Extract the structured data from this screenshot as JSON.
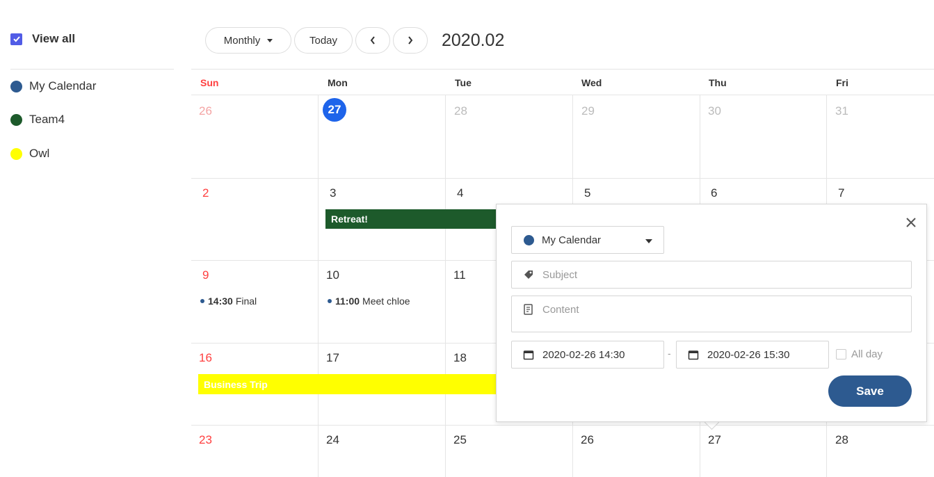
{
  "sidebar": {
    "view_all": "View all",
    "calendars": [
      {
        "name": "My Calendar",
        "color": "#2d5a90"
      },
      {
        "name": "Team4",
        "color": "#1d5a2b"
      },
      {
        "name": "Owl",
        "color": "#ffff00"
      }
    ]
  },
  "toolbar": {
    "view_select": "Monthly",
    "today": "Today",
    "range": "2020.02"
  },
  "calendar": {
    "daynames": [
      "Sun",
      "Mon",
      "Tue",
      "Wed",
      "Thu",
      "Fri"
    ],
    "weeks": [
      [
        "26",
        "27",
        "28",
        "29",
        "30",
        "31"
      ],
      [
        "2",
        "3",
        "4",
        "5",
        "6",
        "7"
      ],
      [
        "9",
        "10",
        "11",
        "",
        "",
        ""
      ],
      [
        "16",
        "17",
        "18",
        "",
        "",
        ""
      ],
      [
        "23",
        "24",
        "25",
        "26",
        "27",
        "28"
      ]
    ],
    "events": {
      "retreat": {
        "title": "Retreat!",
        "color": "#1d5a2b"
      },
      "final": {
        "time": "14:30",
        "title": "Final"
      },
      "meet": {
        "time": "11:00",
        "title": "Meet chloe"
      },
      "trip": {
        "title": "Business Trip",
        "color": "#ffff00"
      }
    }
  },
  "popup": {
    "calendar": "My Calendar",
    "subject_placeholder": "Subject",
    "content_placeholder": "Content",
    "start": "2020-02-26 14:30",
    "end": "2020-02-26 15:30",
    "separator": "-",
    "allday": "All day",
    "save": "Save"
  }
}
